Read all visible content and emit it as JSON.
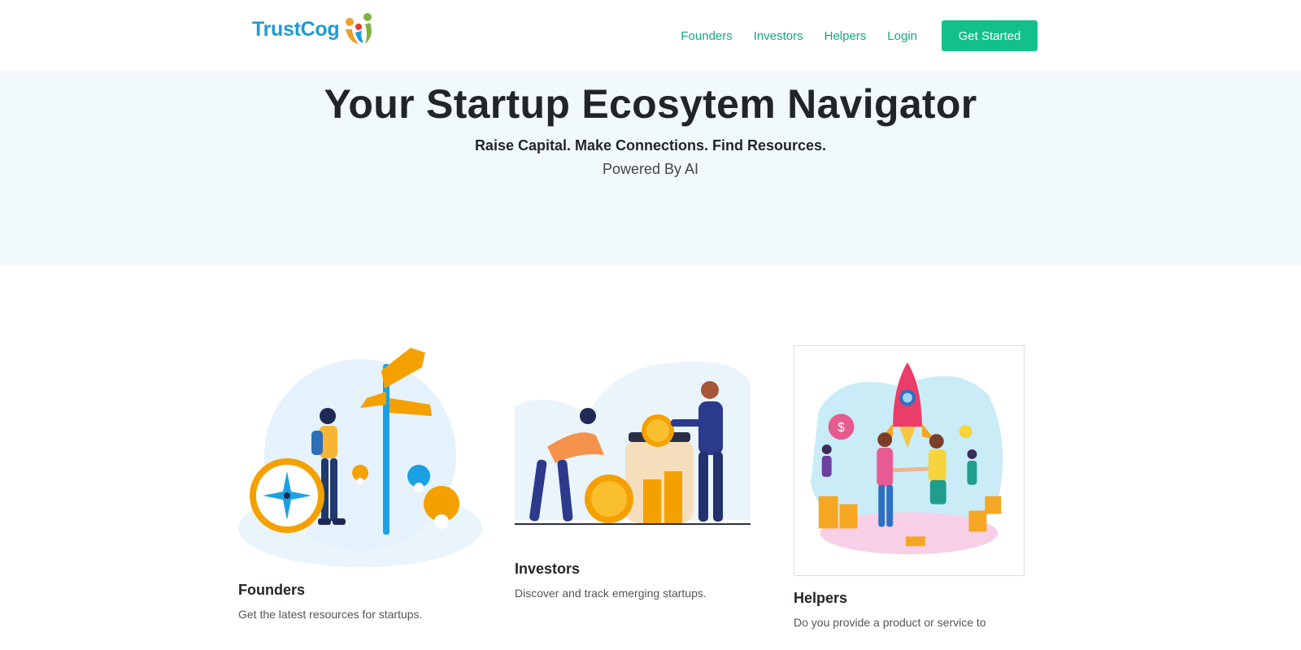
{
  "brand": {
    "name": "TrustCog",
    "logo_icon": "people-logo-icon"
  },
  "nav": {
    "items": [
      {
        "label": "Founders"
      },
      {
        "label": "Investors"
      },
      {
        "label": "Helpers"
      },
      {
        "label": "Login"
      }
    ],
    "cta_label": "Get Started"
  },
  "hero": {
    "title": "Your Startup Ecosytem Navigator",
    "tagline": "Raise Capital. Make Connections. Find Resources.",
    "powered": "Powered By AI"
  },
  "cards": [
    {
      "title": "Founders",
      "description": "Get the latest resources for startups.",
      "illustration": "signpost-compass-illustration"
    },
    {
      "title": "Investors",
      "description": "Discover and track emerging startups.",
      "illustration": "coin-jar-illustration"
    },
    {
      "title": "Helpers",
      "description": "Do you provide a product or service to",
      "illustration": "rocket-handshake-illustration"
    }
  ],
  "colors": {
    "brand_blue": "#1f9bd6",
    "accent_green": "#14c08a",
    "hero_bg": "#f2f9fc",
    "gold": "#f4a100"
  }
}
